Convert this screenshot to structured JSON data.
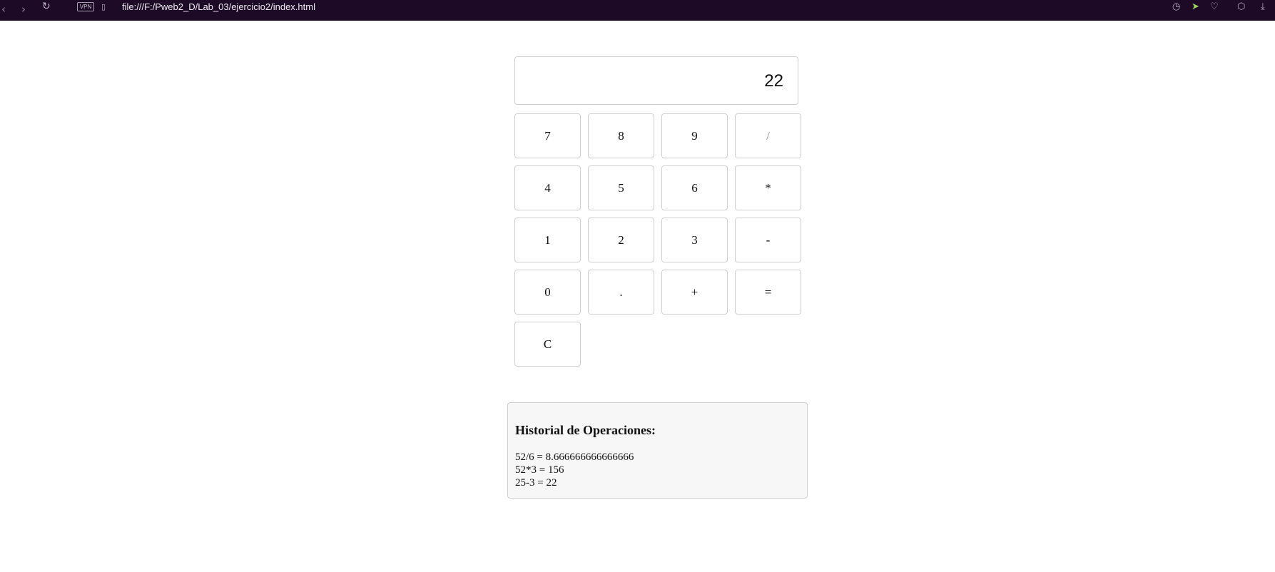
{
  "browser": {
    "url": "file:///F:/Pweb2_D/Lab_03/ejercicio2/index.html",
    "vpn_label": "VPN",
    "icons": {
      "back": "‹",
      "forward": "›",
      "reload": "↻",
      "page": "▯",
      "camera": "◷",
      "send": "➤",
      "heart": "♡",
      "box": "⬡",
      "download": "⤓"
    }
  },
  "calculator": {
    "display_value": "22",
    "keys": [
      {
        "label": "7",
        "muted": false
      },
      {
        "label": "8",
        "muted": false
      },
      {
        "label": "9",
        "muted": false
      },
      {
        "label": "/",
        "muted": true
      },
      {
        "label": "4",
        "muted": false
      },
      {
        "label": "5",
        "muted": false
      },
      {
        "label": "6",
        "muted": false
      },
      {
        "label": "*",
        "muted": false
      },
      {
        "label": "1",
        "muted": false
      },
      {
        "label": "2",
        "muted": false
      },
      {
        "label": "3",
        "muted": false
      },
      {
        "label": "-",
        "muted": false
      },
      {
        "label": "0",
        "muted": false
      },
      {
        "label": ".",
        "muted": false
      },
      {
        "label": "+",
        "muted": false
      },
      {
        "label": "=",
        "muted": false
      },
      {
        "label": "C",
        "muted": false
      }
    ]
  },
  "history": {
    "title": "Historial de Operaciones:",
    "entries": [
      "52/6 = 8.666666666666666",
      "52*3 = 156",
      "25-3 = 22"
    ]
  },
  "colors": {
    "chrome_bg": "#1c0a26",
    "border": "#cfcfcf",
    "history_bg": "#f7f7f7",
    "send_icon": "#9fd35a"
  }
}
